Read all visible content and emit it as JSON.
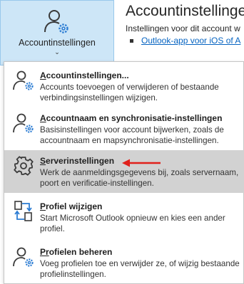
{
  "ribbon": {
    "account_settings_label": "Accountinstellingen",
    "caret": "⌄"
  },
  "background": {
    "title": "Accountinstellingen",
    "description": "Instellingen voor dit account w",
    "link": "Outlook-app voor iOS of A"
  },
  "menu": {
    "items": [
      {
        "title_u": "A",
        "title_rest": "ccountinstellingen...",
        "description": "Accounts toevoegen of verwijderen of bestaande verbindingsinstellingen wijzigen."
      },
      {
        "title_u": "A",
        "title_rest": "ccountnaam en synchronisatie-instellingen",
        "description": "Basisinstellingen voor account bijwerken, zoals de accountnaam en mapsynchronisatie-instellingen."
      },
      {
        "title_u": "S",
        "title_rest": "erverinstellingen",
        "description": "Werk de aanmeldingsgegevens bij, zoals servernaam, poort en verificatie-instellingen."
      },
      {
        "title_u": "P",
        "title_rest": "rofiel wijzigen",
        "description": "Start  Microsoft Outlook opnieuw en kies een ander profiel."
      },
      {
        "title_u": "Pr",
        "title_rest": "ofielen beheren",
        "description": "Voeg profielen toe en verwijder ze, of wijzig bestaande profielinstellingen."
      }
    ]
  },
  "colors": {
    "ribbon_bg": "#cde6f7",
    "highlight_bg": "#d2d2d2",
    "accent_blue": "#2b7cd3",
    "arrow_red": "#e0201b",
    "link": "#0563c1"
  }
}
